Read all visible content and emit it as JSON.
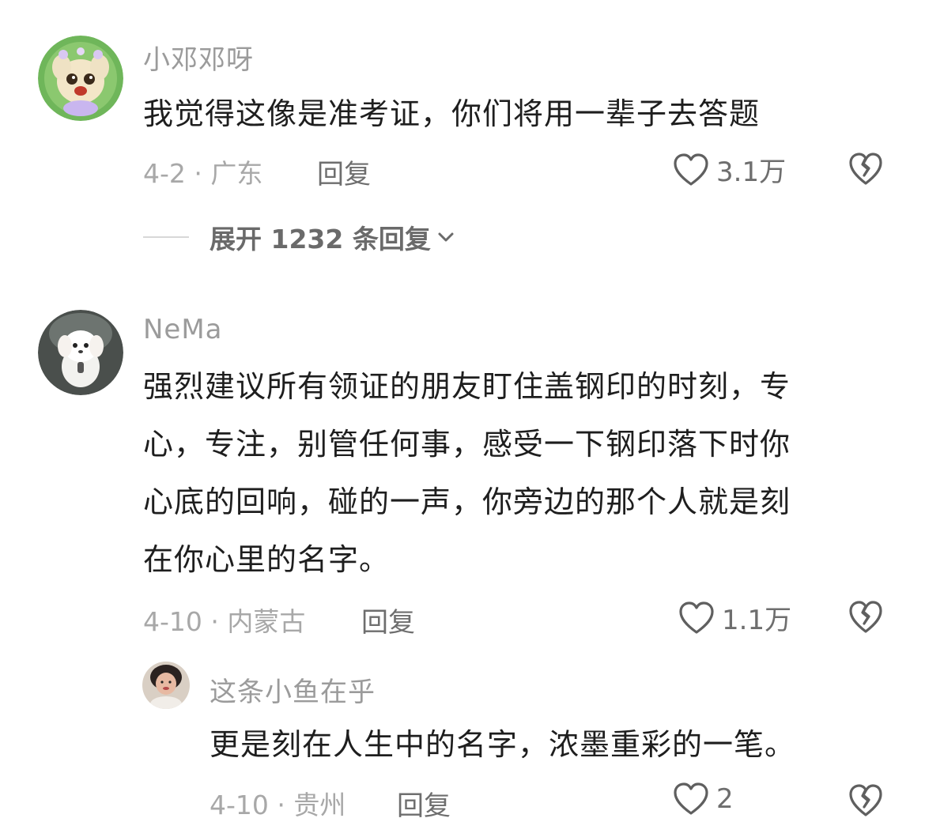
{
  "comments": [
    {
      "username": "小邓邓呀",
      "text": "我觉得这像是准考证，你们将用一辈子去答题",
      "meta": "4-2 · 广东",
      "reply_label": "回复",
      "likes": "3.1万",
      "avatar_icon": "cartoon-avatar-icon",
      "expand_label": "展开 1232 条回复"
    },
    {
      "username": "NeMa",
      "text_lines": [
        "强烈建议所有领证的朋友盯住盖钢印的时刻，专",
        "心，专注，别管任何事，感受一下钢印落下时你",
        "心底的回响，碰的一声，你旁边的那个人就是刻",
        "在你心里的名字。"
      ],
      "meta": "4-10 · 内蒙古",
      "reply_label": "回复",
      "likes": "1.1万",
      "avatar_icon": "white-puppy-avatar-icon"
    }
  ],
  "reply": {
    "username": "这条小鱼在乎",
    "text": "更是刻在人生中的名字，浓墨重彩的一笔。",
    "meta": "4-10 · 贵州",
    "reply_label": "回复",
    "likes": "2",
    "avatar_icon": "photo-avatar-icon"
  },
  "colors": {
    "username": "#9b9b9b",
    "meta": "#a8a8a8",
    "text": "#1e1e1e",
    "action": "#6e6e6e"
  }
}
